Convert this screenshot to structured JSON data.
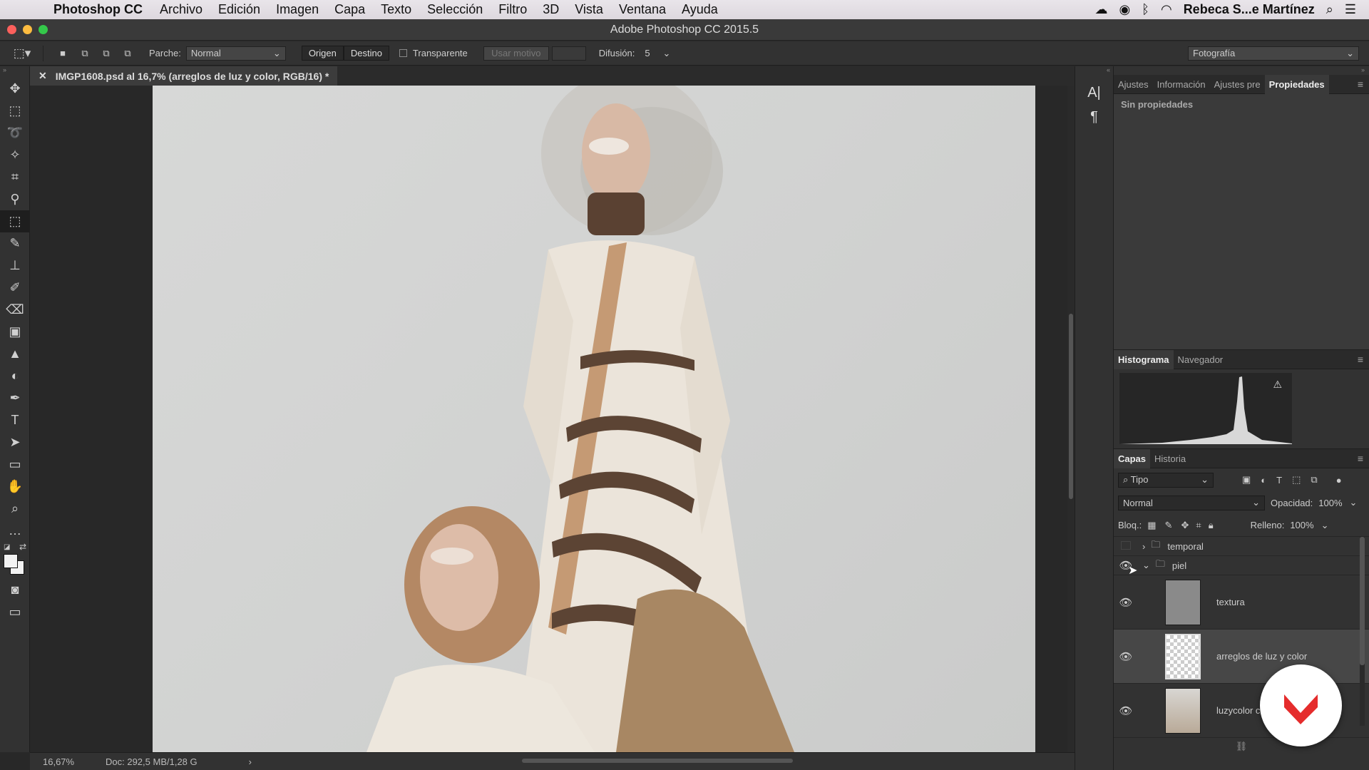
{
  "menubar": {
    "app": "Photoshop CC",
    "items": [
      "Archivo",
      "Edición",
      "Imagen",
      "Capa",
      "Texto",
      "Selección",
      "Filtro",
      "3D",
      "Vista",
      "Ventana",
      "Ayuda"
    ],
    "user": "Rebeca S...e Martínez"
  },
  "window": {
    "title": "Adobe Photoshop CC 2015.5"
  },
  "options": {
    "parche_label": "Parche:",
    "parche_value": "Normal",
    "origen": "Origen",
    "destino": "Destino",
    "transparente": "Transparente",
    "usar_motivo": "Usar motivo",
    "difusion_label": "Difusión:",
    "difusion_value": "5",
    "workspace": "Fotografía"
  },
  "document": {
    "tab": "IMGP1608.psd al 16,7% (arreglos de luz y color, RGB/16) *"
  },
  "status": {
    "zoom": "16,67%",
    "doc": "Doc: 292,5 MB/1,28 G"
  },
  "properties": {
    "tabs": [
      "Ajustes",
      "Información",
      "Ajustes pre",
      "Propiedades"
    ],
    "empty": "Sin propiedades"
  },
  "histogram": {
    "tabs": [
      "Histograma",
      "Navegador"
    ]
  },
  "layers": {
    "tabs": [
      "Capas",
      "Historia"
    ],
    "filter": "Tipo",
    "blend": "Normal",
    "opacity_label": "Opacidad:",
    "opacity": "100%",
    "lock_label": "Bloq.:",
    "fill_label": "Relleno:",
    "fill": "100%",
    "items": [
      {
        "name": "temporal"
      },
      {
        "name": "piel"
      },
      {
        "name": "textura"
      },
      {
        "name": "arreglos de luz y color"
      },
      {
        "name": "luzycolor co"
      }
    ]
  },
  "colors": {
    "accent": "#e52c2c",
    "panel": "#323232"
  }
}
